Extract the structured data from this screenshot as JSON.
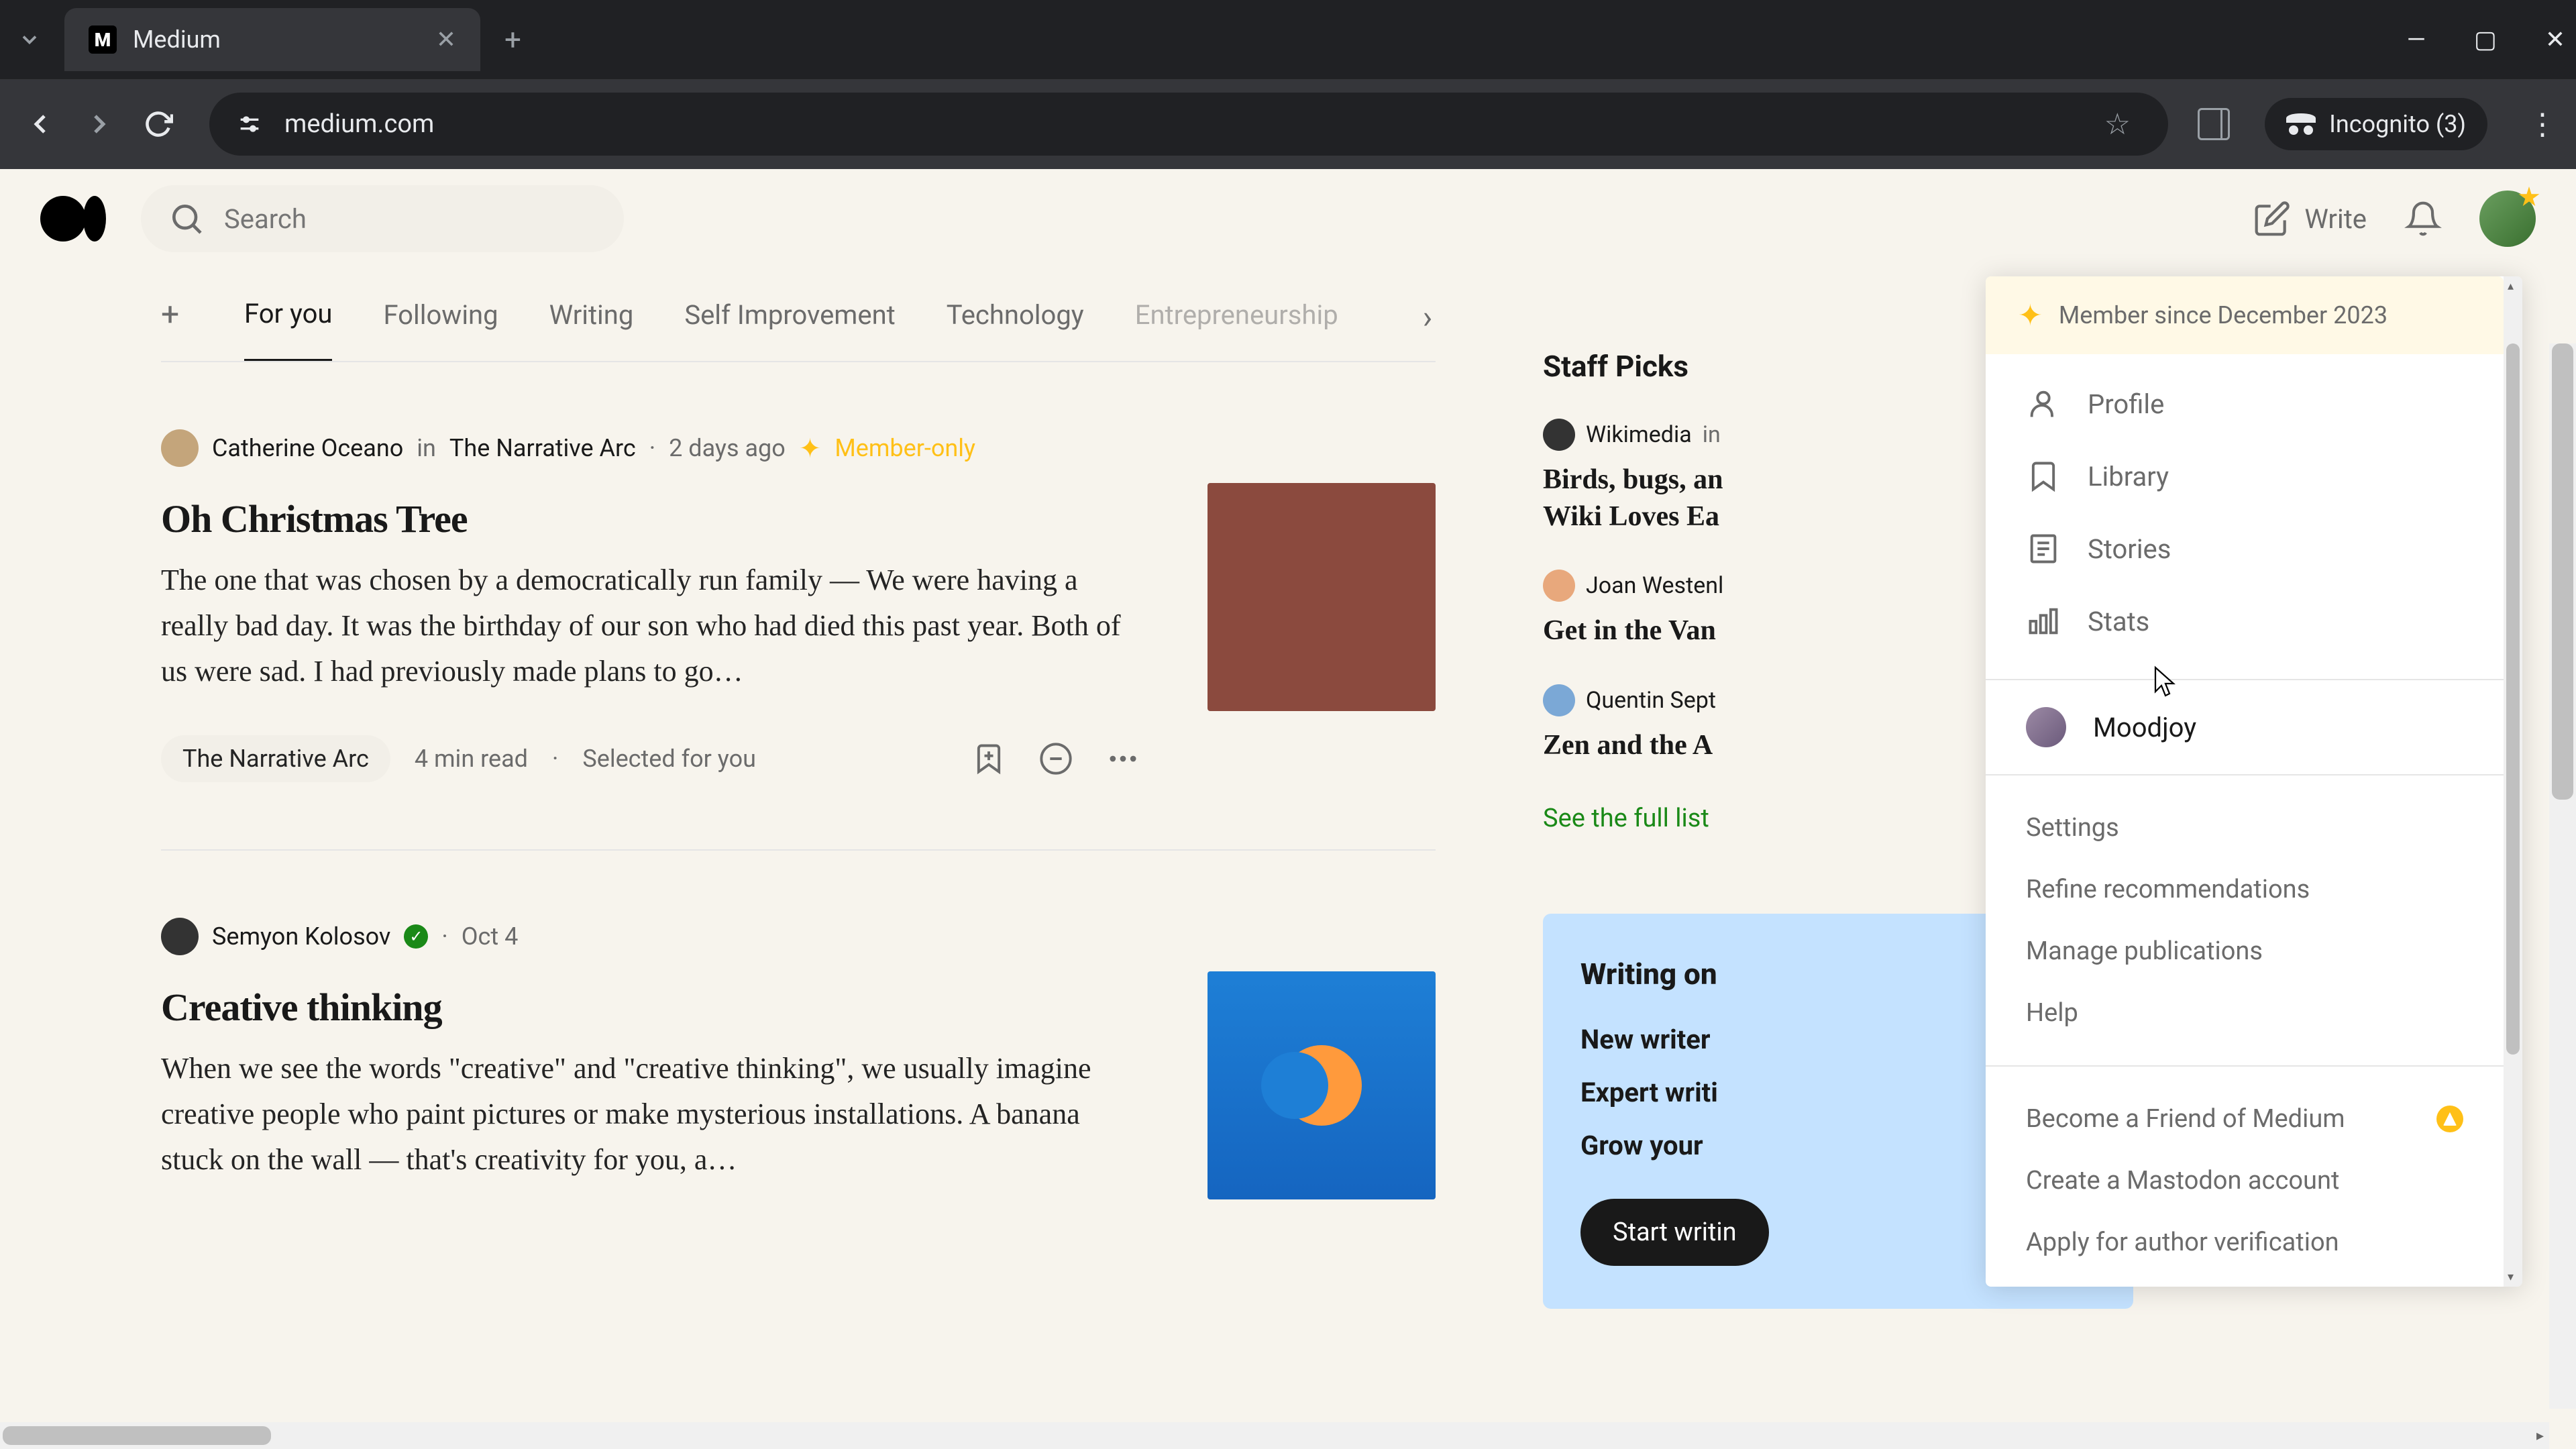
{
  "browser": {
    "tab_title": "Medium",
    "url": "medium.com",
    "incognito_label": "Incognito (3)"
  },
  "header": {
    "search_placeholder": "Search",
    "write_label": "Write"
  },
  "tabs": {
    "items": [
      "For you",
      "Following",
      "Writing",
      "Self Improvement",
      "Technology",
      "Entrepreneurship"
    ]
  },
  "articles": [
    {
      "author": "Catherine Oceano",
      "in_word": "in",
      "publication": "The Narrative Arc",
      "date": "2 days ago",
      "member_only": "Member-only",
      "title": "Oh Christmas Tree",
      "excerpt": "The one that was chosen by a democratically run family — We were having a really bad day. It was the birthday of our son who had died this past year. Both of us were sad. I had previously made plans to go…",
      "topic": "The Narrative Arc",
      "read_time": "4 min read",
      "selected": "Selected for you"
    },
    {
      "author": "Semyon Kolosov",
      "date": "Oct 4",
      "title": "Creative thinking",
      "excerpt": "When we see the words \"creative\" and \"creative thinking\", we usually imagine creative people who paint pictures or make mysterious installations. A banana stuck on the wall — that's creativity for you, a…"
    }
  ],
  "staff_picks": {
    "title": "Staff Picks",
    "items": [
      {
        "author": "Wikimedia",
        "in_word": "in",
        "title": "Birds, bugs, an\nWiki Loves Ea"
      },
      {
        "author": "Joan Westenl",
        "title": "Get in the Van"
      },
      {
        "author": "Quentin Sept",
        "title": "Zen and the A"
      }
    ],
    "see_all": "See the full list"
  },
  "write_card": {
    "title": "Writing on",
    "items": [
      "New writer",
      "Expert writi",
      "Grow your"
    ],
    "button": "Start writin"
  },
  "dropdown": {
    "member_since": "Member since December 2023",
    "main_items": [
      {
        "icon": "profile",
        "label": "Profile"
      },
      {
        "icon": "library",
        "label": "Library"
      },
      {
        "icon": "stories",
        "label": "Stories"
      },
      {
        "icon": "stats",
        "label": "Stats"
      }
    ],
    "user_name": "Moodjoy",
    "settings_items": [
      "Settings",
      "Refine recommendations",
      "Manage publications",
      "Help"
    ],
    "extra_items": [
      "Become a Friend of Medium",
      "Create a Mastodon account",
      "Apply for author verification"
    ]
  }
}
